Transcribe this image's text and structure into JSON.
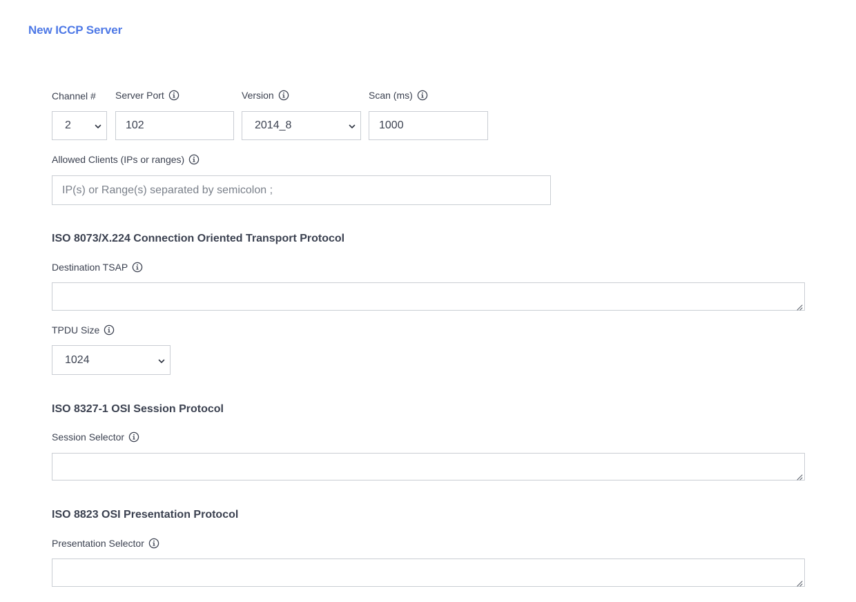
{
  "page": {
    "title": "New ICCP Server"
  },
  "general": {
    "channel": {
      "label": "Channel #",
      "value": "2"
    },
    "server_port": {
      "label": "Server Port",
      "value": "102"
    },
    "version": {
      "label": "Version",
      "value": "2014_8"
    },
    "scan": {
      "label": "Scan (ms)",
      "value": "1000"
    },
    "allowed_clients": {
      "label": "Allowed Clients (IPs or ranges)",
      "placeholder": "IP(s) or Range(s) separated by semicolon ;",
      "value": ""
    }
  },
  "transport": {
    "heading": "ISO 8073/X.224 Connection Oriented Transport Protocol",
    "destination_tsap": {
      "label": "Destination TSAP",
      "value": ""
    },
    "tpdu_size": {
      "label": "TPDU Size",
      "value": "1024"
    }
  },
  "session": {
    "heading": "ISO 8327-1 OSI Session Protocol",
    "session_selector": {
      "label": "Session Selector",
      "value": ""
    }
  },
  "presentation": {
    "heading": "ISO 8823 OSI Presentation Protocol",
    "presentation_selector": {
      "label": "Presentation Selector",
      "value": ""
    }
  },
  "icons": {
    "info": "info-circle-icon",
    "dropdown": "chevron-down-icon",
    "resize": "resize-grip-icon"
  },
  "colors": {
    "title": "#4d78e6",
    "text": "#3b4150",
    "border": "#c9cdd3",
    "placeholder": "#7a808a"
  }
}
